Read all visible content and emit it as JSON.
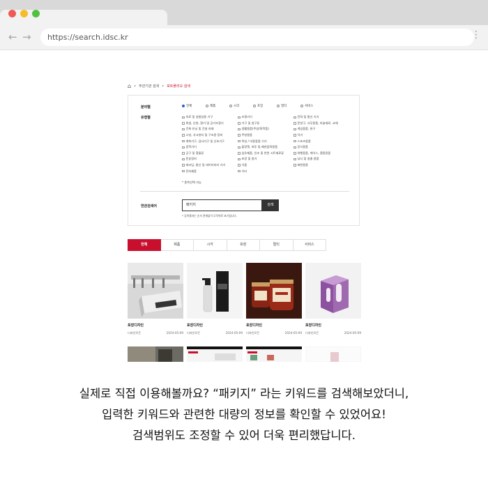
{
  "browser": {
    "url": "https://search.idsc.kr",
    "traffic_colors": [
      "#ee5b54",
      "#f5bd2e",
      "#52c13f"
    ]
  },
  "breadcrumb": {
    "items": [
      "주관기관 검색",
      "포트폴리오 검색"
    ]
  },
  "filters": {
    "field_label": "분야별",
    "fields": [
      "전체",
      "제품",
      "시각",
      "포장",
      "멀티",
      "서비스"
    ],
    "type_label": "유형별",
    "types": [
      "의료 및 실험실용 기구",
      "조명기기",
      "전화 및 통신 기기",
      "위생, 난방, 환기 및 공기조절기",
      "가구 및 침구류",
      "문방구, 사무용품, 미술재료, 교재",
      "건축 유닛 및 건설 자재",
      "생활용품(주방/화학품)",
      "게임용품, 완구",
      "소방, 사고방지 및 구조용 장비",
      "주방용품",
      "악기",
      "계측기구, 검사기구 및 신호기구",
      "욕실 / 미용용품 기기",
      "스포츠용품",
      "광학기기",
      "플랑켓, 외투 및 패션잡화용품",
      "장식용품",
      "공구 및 철물류",
      "섬유제품, 인조 및 천연 시트재료류",
      "여행용품, 케이스, 캠핑용품",
      "운송장비",
      "포장 및 용기",
      "낚시 및 살충 용품",
      "레코딩, 통신 및 데이터처리 기기",
      "식품",
      "애완용품",
      "전자제품",
      "기타"
    ],
    "multi_note": "* 중복선택 가능",
    "search_label": "연관검색어",
    "search_value": "패키지",
    "search_button": "검색",
    "search_note": "* 검색결과는 순서 관계없이 무작위로 표기됩니다."
  },
  "result_tabs": [
    "전체",
    "제품",
    "시각",
    "포장",
    "멀티",
    "서비스"
  ],
  "cards": [
    {
      "title": "포장디자인",
      "company": "디자인모든",
      "date": "2024-05-09"
    },
    {
      "title": "포장디자인",
      "company": "디자인모든",
      "date": "2024-05-09"
    },
    {
      "title": "포장디자인",
      "company": "디자인모든",
      "date": "2024-05-09"
    },
    {
      "title": "포장디자인",
      "company": "디자인모든",
      "date": "2024-05-09"
    }
  ],
  "caption": {
    "line1": "실제로 직접 이용해볼까요? “패키지” 라는 키워드를 검색해보았더니,",
    "line2": "입력한 키워드와 관련한 대량의 정보를 확인할 수 있었어요!",
    "line3": "검색범위도 조정할 수 있어 더욱 편리했답니다."
  },
  "colors": {
    "accent": "#c8102e",
    "radio_selected": "#2c5ec9"
  }
}
